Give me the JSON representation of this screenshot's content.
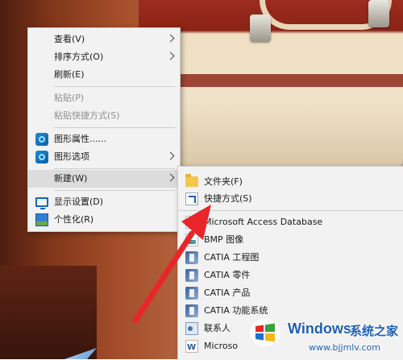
{
  "context_menu": {
    "items": [
      {
        "label": "查看(V)",
        "has_submenu": true
      },
      {
        "label": "排序方式(O)",
        "has_submenu": true
      },
      {
        "label": "刷新(E)"
      },
      {
        "label": "粘贴(P)",
        "disabled": true
      },
      {
        "label": "粘贴快捷方式(S)",
        "disabled": true
      },
      {
        "label": "图形属性......",
        "icon": "graphics-icon"
      },
      {
        "label": "图形选项",
        "icon": "graphics-icon",
        "has_submenu": true
      },
      {
        "label": "新建(W)",
        "has_submenu": true,
        "highlighted": true
      },
      {
        "label": "显示设置(D)",
        "icon": "display-icon"
      },
      {
        "label": "个性化(R)",
        "icon": "personalize-icon"
      }
    ]
  },
  "new_submenu": {
    "items": [
      {
        "label": "文件夹(F)",
        "icon": "folder-icon"
      },
      {
        "label": "快捷方式(S)",
        "icon": "shortcut-icon"
      },
      {
        "label": "Microsoft Access Database",
        "icon": "access-icon"
      },
      {
        "label": "BMP 图像",
        "icon": "bmp-image-icon"
      },
      {
        "label": "CATIA 工程图",
        "icon": "catia-icon"
      },
      {
        "label": "CATIA 零件",
        "icon": "catia-icon"
      },
      {
        "label": "CATIA 产品",
        "icon": "catia-icon"
      },
      {
        "label": "CATIA 功能系统",
        "icon": "catia-icon"
      },
      {
        "label": "联系人",
        "icon": "contact-icon"
      },
      {
        "label": "Microso",
        "icon": "word-icon"
      }
    ]
  },
  "watermark": {
    "title": "Windows",
    "subtitle": "系统之家",
    "url": "www.bjjmlv.com"
  },
  "colors": {
    "annotation_arrow": "#e8262a",
    "menu_background": "#f2f2f2",
    "highlight": "#dcdcdc",
    "watermark_blue": "#1f5fb0"
  }
}
